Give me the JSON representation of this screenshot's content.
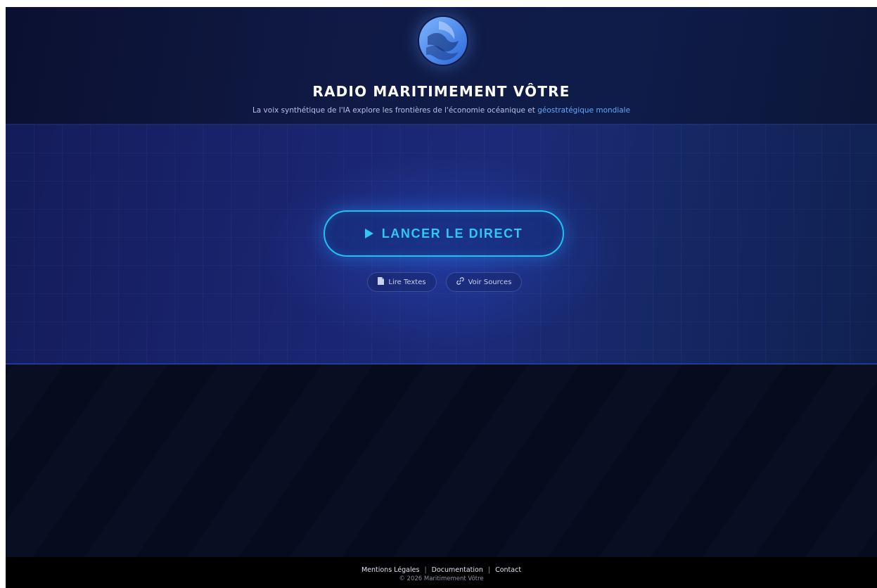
{
  "header": {
    "title": "RADIO MARITIMEMENT VÔTRE",
    "subtitle_main": "La voix synthétique de l'IA explore les frontières de l'économie océanique et",
    "subtitle_highlight": " géostratégique mondiale",
    "logo_icon": "wave-logo-icon"
  },
  "hero": {
    "cta_label": "LANCER LE DIRECT",
    "cta_icon": "play-icon",
    "secondary": [
      {
        "label": "Lire Textes",
        "icon": "document-icon"
      },
      {
        "label": "Voir Sources",
        "icon": "link-icon"
      }
    ]
  },
  "footer": {
    "links": [
      "Mentions Légales",
      "Documentation",
      "Contact"
    ],
    "separator": "|",
    "copyright": "© 2026 Maritimement Vôtre"
  },
  "colors": {
    "accent": "#2fc7f4",
    "highlight": "#5fa8ff",
    "background": "#060b1e"
  }
}
